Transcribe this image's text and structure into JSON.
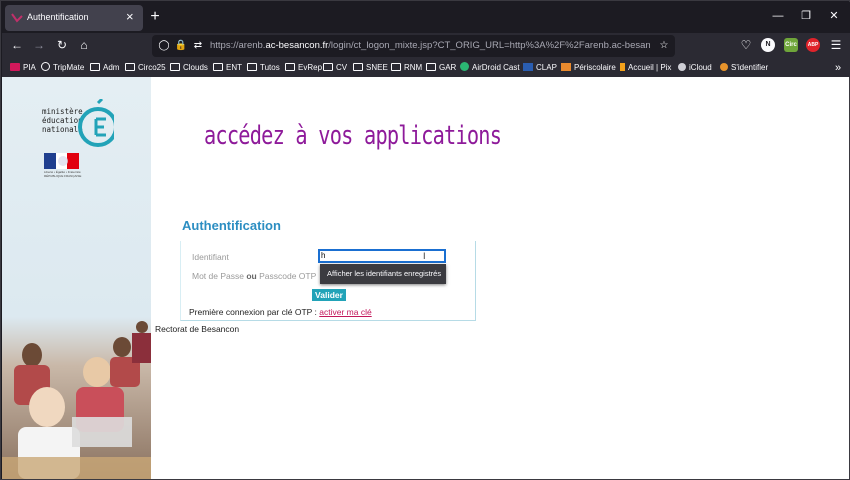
{
  "browser": {
    "tab_title": "Authentification",
    "tab_close": "×",
    "new_tab": "+",
    "url_prefix": "https://arenb.",
    "url_host": "ac-besancon.fr",
    "url_rest": "/login/ct_logon_mixte.jsp?CT_ORIG_URL=http%3A%2F%2Farenb.ac-besancon.fr%2Fsso%",
    "profile_initial": "N",
    "badge_text": "Circ",
    "abp_text": "ABP"
  },
  "bookmarks": [
    {
      "label": "PIA",
      "icon": "pia-icon"
    },
    {
      "label": "TripMate",
      "icon": "globe-icon"
    },
    {
      "label": "Adm",
      "icon": "folder-icon"
    },
    {
      "label": "Circo25",
      "icon": "folder-icon"
    },
    {
      "label": "Clouds",
      "icon": "folder-icon"
    },
    {
      "label": "ENT",
      "icon": "folder-icon"
    },
    {
      "label": "Tutos",
      "icon": "folder-icon"
    },
    {
      "label": "EvRep",
      "icon": "folder-icon"
    },
    {
      "label": "CV",
      "icon": "folder-icon"
    },
    {
      "label": "SNEE",
      "icon": "folder-icon"
    },
    {
      "label": "RNM",
      "icon": "folder-icon"
    },
    {
      "label": "GAR",
      "icon": "folder-icon"
    },
    {
      "label": "AirDroid Cast",
      "icon": "airdroid-icon"
    },
    {
      "label": "CLAP",
      "icon": "clap-icon"
    },
    {
      "label": "Périscolaire",
      "icon": "periscolaire-icon"
    },
    {
      "label": "Accueil | Pix",
      "icon": "pix-icon"
    },
    {
      "label": "iCloud",
      "icon": "apple-icon"
    },
    {
      "label": "S'identifier",
      "icon": "user-icon"
    }
  ],
  "logo": {
    "lines": [
      "ministère",
      "éducation",
      "nationale"
    ],
    "flag_caption": "Liberté • Égalité • Fraternité  RÉPUBLIQUE FRANÇAISE"
  },
  "page": {
    "headline": "accédez à vos applications",
    "auth_title": "Authentification",
    "identifiant_label": "Identifiant",
    "identifiant_value": "h",
    "password_label_a": "Mot de Passe ",
    "password_label_or": "ou",
    "password_label_b": " Passcode OTP",
    "autocomplete_text": "Afficher les identifiants enregistrés",
    "submit_label": "Valider",
    "otp_text": "Première connexion par clé OTP : ",
    "otp_link": "activer ma clé",
    "footer": "Rectorat de Besancon"
  },
  "colors": {
    "headline": "#8e1a9a",
    "auth_title": "#2c8ec2",
    "submit_bg": "#22a3b8",
    "link": "#c2185b"
  }
}
